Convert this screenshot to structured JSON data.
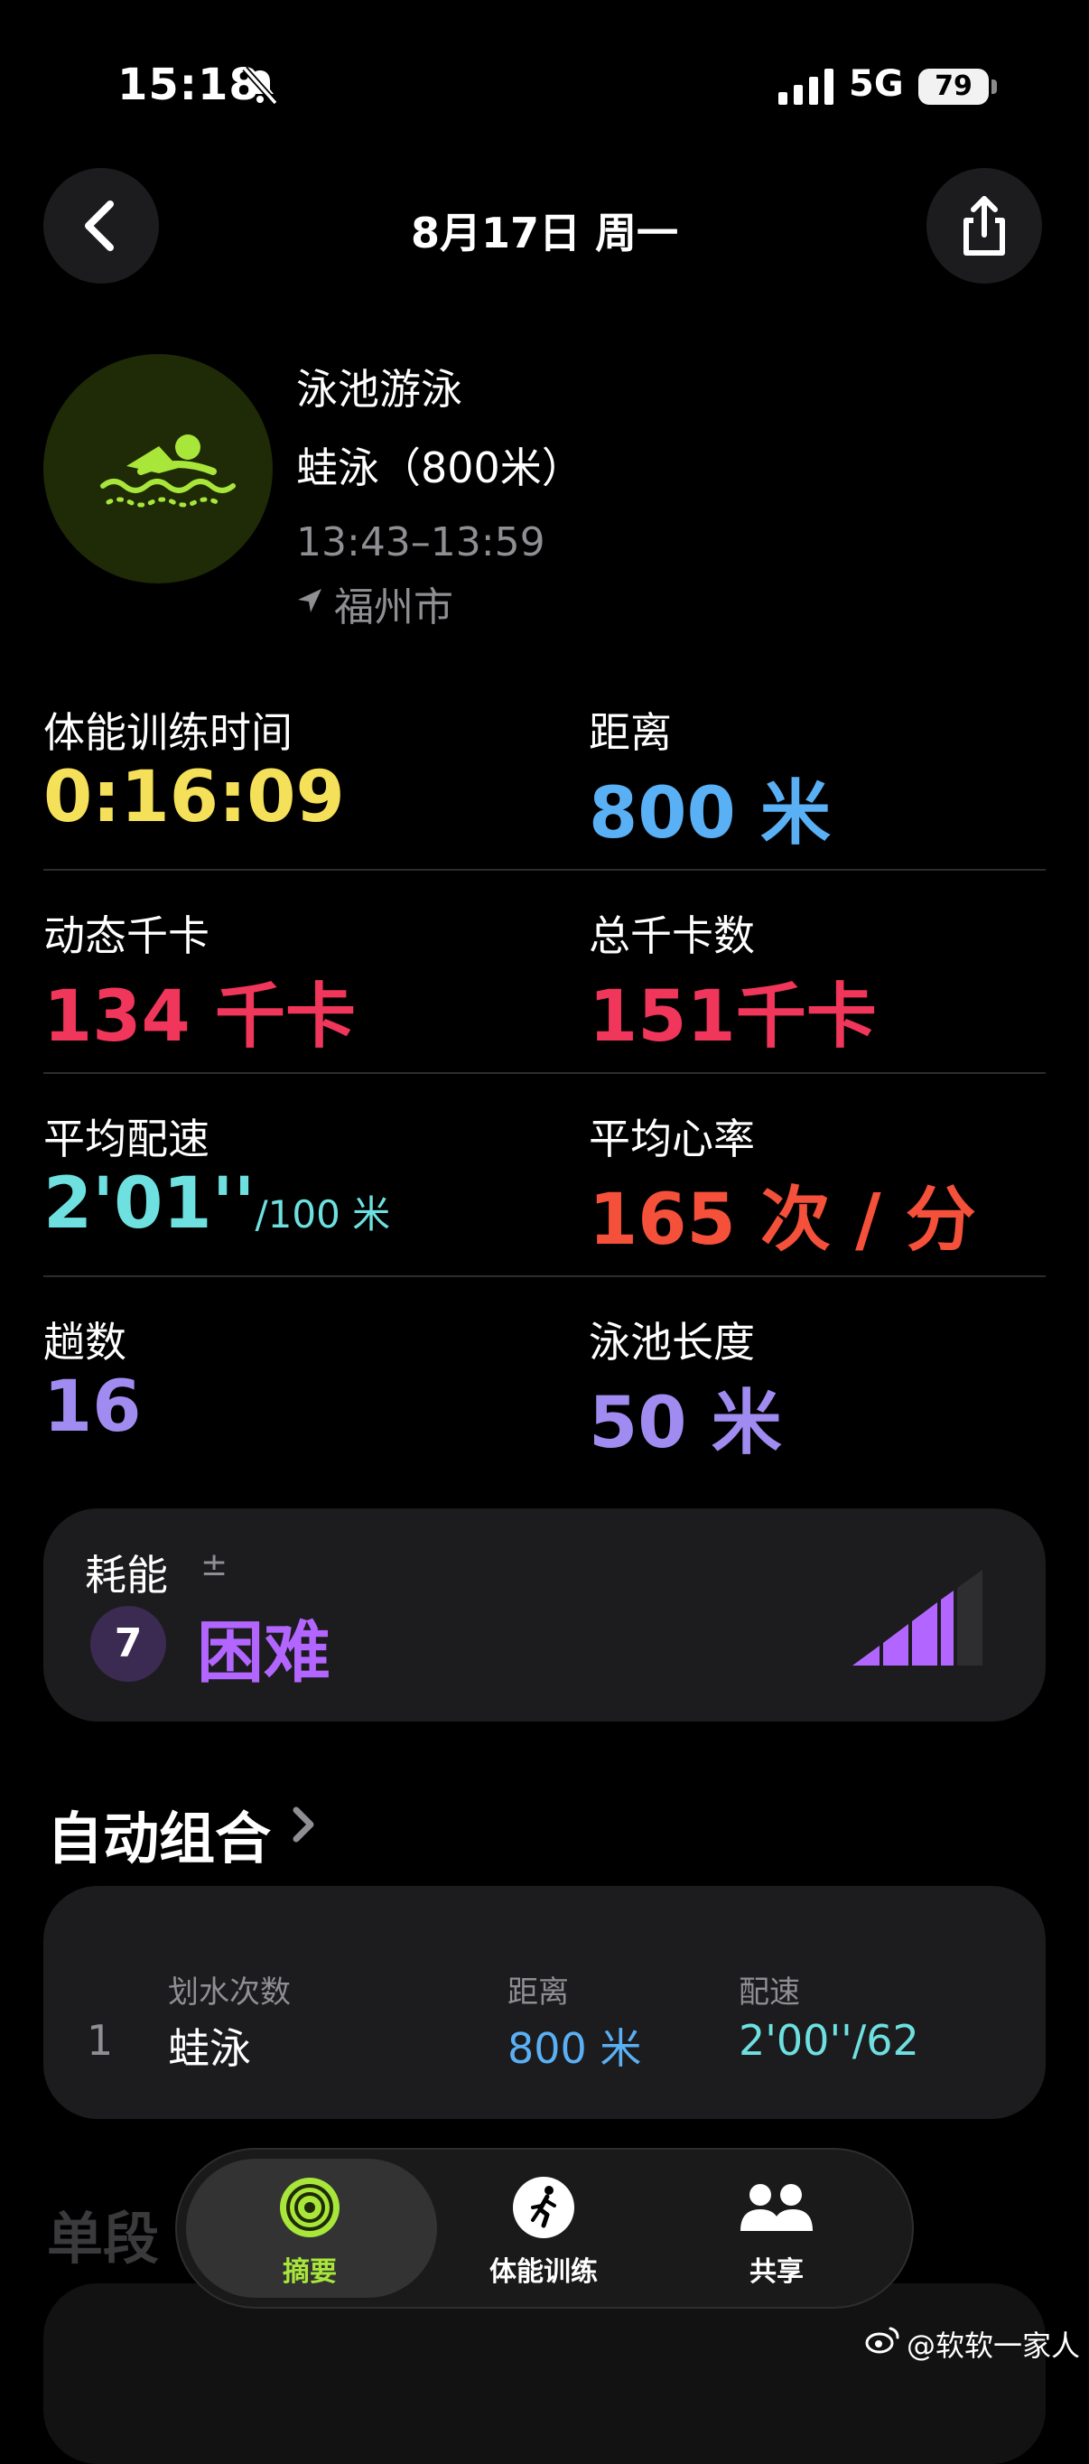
{
  "status_bar": {
    "time": "15:18",
    "network": "5G",
    "battery": "79"
  },
  "nav": {
    "title": "8月17日 周一"
  },
  "workout": {
    "type": "泳池游泳",
    "subtitle": "蛙泳（800米）",
    "time_range": "13:43–13:59",
    "location": "福州市",
    "accent": "#a8e63a"
  },
  "metrics": [
    {
      "label": "体能训练时间",
      "value": "0:16:09",
      "unit": "",
      "color": "#f5e05a"
    },
    {
      "label": "距离",
      "value": "800",
      "unit": "米",
      "color": "#5ab0f5"
    },
    {
      "label": "动态千卡",
      "value": "134",
      "unit": "千卡",
      "color": "#f0365a"
    },
    {
      "label": "总千卡数",
      "value": "151",
      "unit": "千卡",
      "color": "#f0365a"
    },
    {
      "label": "平均配速",
      "value": "2'01''",
      "unit": "/100 米",
      "color": "#6ee0e0"
    },
    {
      "label": "平均心率",
      "value": "165",
      "unit": "次 / 分",
      "color": "#f5503a"
    },
    {
      "label": "趟数",
      "value": "16",
      "unit": "",
      "color": "#a08cf0"
    },
    {
      "label": "泳池长度",
      "value": "50",
      "unit": "米",
      "color": "#a08cf0"
    }
  ],
  "effort": {
    "label": "耗能",
    "adjust_symbol": "±",
    "level": "7",
    "text": "困难",
    "level_fraction": 0.7,
    "color": "#b266ff"
  },
  "auto_sets": {
    "title": "自动组合",
    "headers": {
      "strokes": "划水次数",
      "distance": "距离",
      "pace": "配速"
    },
    "rows": [
      {
        "index": "1",
        "stroke": "蛙泳",
        "distance": "800 米",
        "pace": "2'00''/62"
      }
    ]
  },
  "segments": {
    "title": "单段"
  },
  "tabs": [
    {
      "label": "摘要",
      "icon": "activity-rings-icon",
      "active": true
    },
    {
      "label": "体能训练",
      "icon": "running-figure-icon",
      "active": false
    },
    {
      "label": "共享",
      "icon": "people-icon",
      "active": false
    }
  ],
  "watermark": "@软软一家人"
}
